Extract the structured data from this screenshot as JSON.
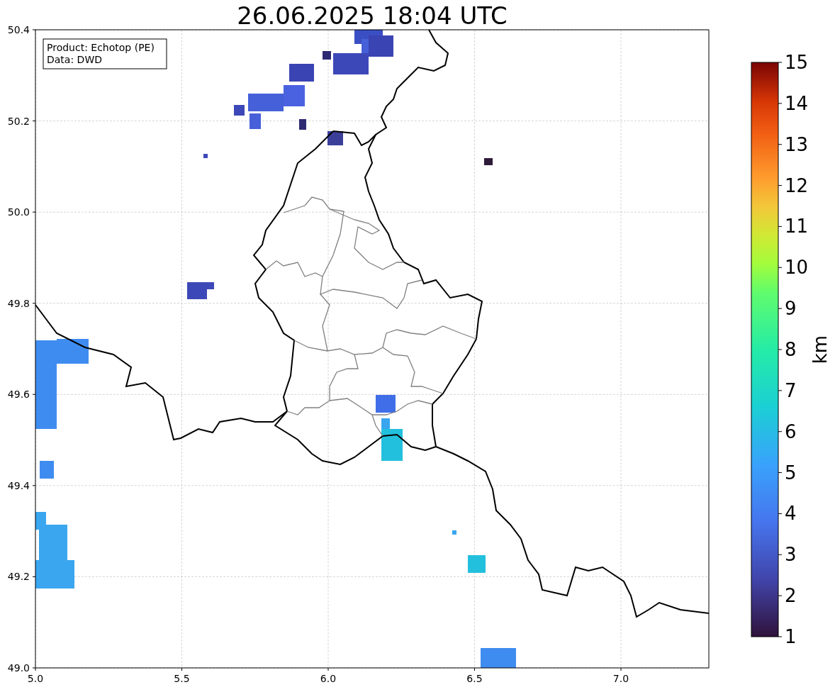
{
  "title": "26.06.2025 18:04 UTC",
  "legend": [
    "Product: Echotop (PE)",
    "Data: DWD"
  ],
  "x_axis": {
    "ticks": [
      "5.0",
      "5.5",
      "6.0",
      "6.5",
      "7.0"
    ]
  },
  "y_axis": {
    "ticks": [
      "50.4",
      "50.2",
      "50.0",
      "49.8",
      "49.6",
      "49.4",
      "49.2",
      "49.0"
    ]
  },
  "colorbar": {
    "label": "km",
    "ticks": [
      "15",
      "14",
      "13",
      "12",
      "11",
      "10",
      "9",
      "8",
      "7",
      "6",
      "5",
      "4",
      "3",
      "2",
      "1"
    ]
  }
}
